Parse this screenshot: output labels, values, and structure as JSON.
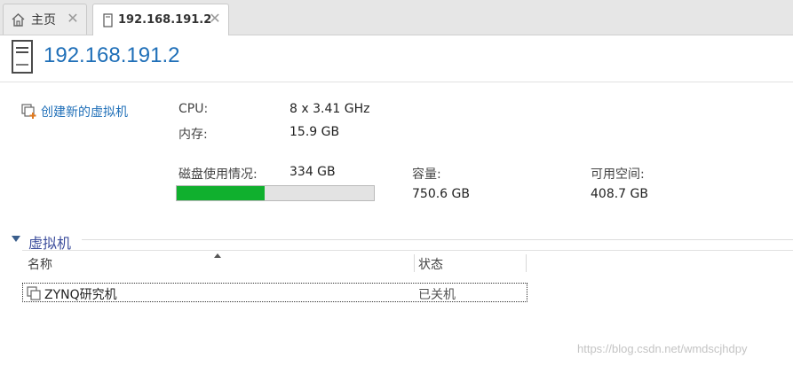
{
  "tabs": [
    {
      "label": "主页",
      "active": false,
      "icon": "home-icon"
    },
    {
      "label": "192.168.191.2",
      "active": true,
      "icon": "host-icon"
    }
  ],
  "header": {
    "title": "192.168.191.2",
    "icon": "host-icon"
  },
  "actions": {
    "create_vm_label": "创建新的虚拟机",
    "create_vm_icon": "create-vm-icon"
  },
  "info": {
    "cpu_label": "CPU:",
    "cpu_value": "8 x 3.41 GHz",
    "memory_label": "内存:",
    "memory_value": "15.9 GB",
    "disk_label": "磁盘使用情况:",
    "disk_value": "334 GB",
    "disk_used_fraction": 0.444,
    "capacity_label": "容量:",
    "capacity_value": "750.6 GB",
    "free_label": "可用空间:",
    "free_value": "408.7 GB"
  },
  "vm_section": {
    "title": "虚拟机",
    "columns": [
      "名称",
      "状态"
    ],
    "rows": [
      {
        "name": "ZYNQ研究机",
        "status": "已关机"
      }
    ]
  },
  "watermark": "https://blog.csdn.net/wmdscjhdpy",
  "colors": {
    "accent": "#1f6fb8",
    "section_title": "#3c4d9c",
    "disk_fill": "#10b02e"
  }
}
